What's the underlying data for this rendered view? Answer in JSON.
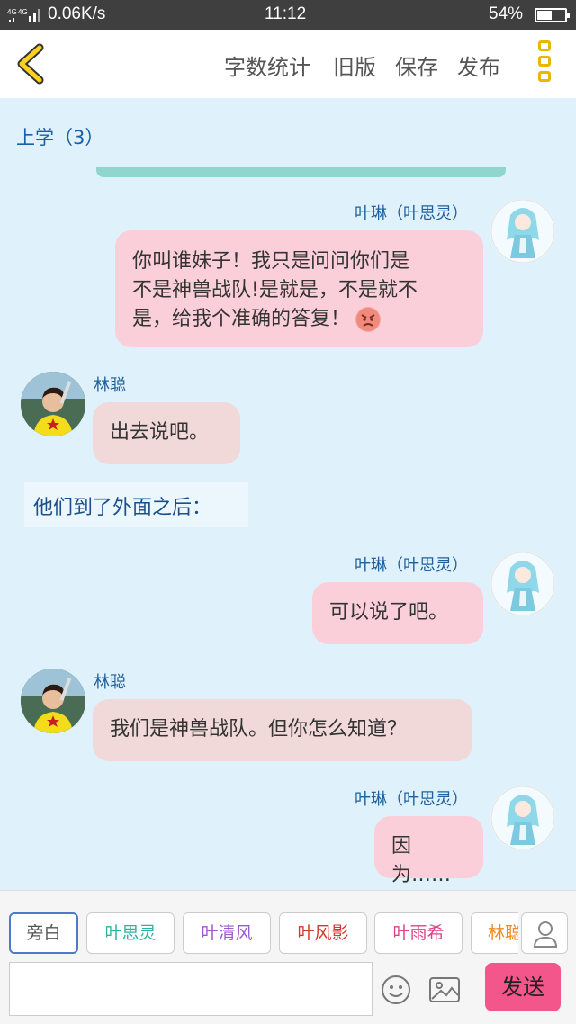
{
  "status_bar": {
    "network": "4G 4G",
    "speed": "0.06K/s",
    "time": "11:12",
    "battery_percent": "54%",
    "battery_level": 0.54
  },
  "toolbar": {
    "back_icon": "chevron-left-icon",
    "word_count": "字数统计",
    "old_version": "旧版",
    "save": "保存",
    "publish": "发布",
    "menu_icon": "vertical-dots-icon",
    "accent_color": "#e8b800"
  },
  "chat": {
    "section_title": "上学（3）",
    "messages": [
      {
        "speaker": "叶琳（叶思灵）",
        "side": "right",
        "text_lines": [
          "你叫谁妹子！我只是问问你们是",
          "不是神兽战队!是就是，不是就不",
          "是，给我个准确的答复！"
        ],
        "emoji": "angry-face-icon"
      },
      {
        "speaker": "林聪",
        "side": "left",
        "text_lines": [
          "出去说吧。"
        ]
      },
      {
        "speaker": "",
        "side": "narration",
        "text_lines": [
          "他们到了外面之后："
        ]
      },
      {
        "speaker": "叶琳（叶思灵）",
        "side": "right",
        "text_lines": [
          "可以说了吧。"
        ]
      },
      {
        "speaker": "林聪",
        "side": "left",
        "text_lines": [
          "我们是神兽战队。但你怎么知道？"
        ]
      },
      {
        "speaker": "叶琳（叶思灵）",
        "side": "right",
        "text_lines": [
          "因为……"
        ]
      }
    ]
  },
  "role_chips": [
    {
      "label": "旁白",
      "color": "#555555",
      "active": true
    },
    {
      "label": "叶思灵",
      "color": "#2bb5a0",
      "active": false
    },
    {
      "label": "叶清风",
      "color": "#9b59d0",
      "active": false
    },
    {
      "label": "叶风影",
      "color": "#d23a2a",
      "active": false
    },
    {
      "label": "叶雨希",
      "color": "#e0408a",
      "active": false
    },
    {
      "label": "林聪",
      "color": "#f08a24",
      "active": false
    }
  ],
  "composer": {
    "input_value": "",
    "emoji_icon": "smiley-icon",
    "image_icon": "image-icon",
    "person_icon": "person-icon",
    "send": "发送"
  }
}
